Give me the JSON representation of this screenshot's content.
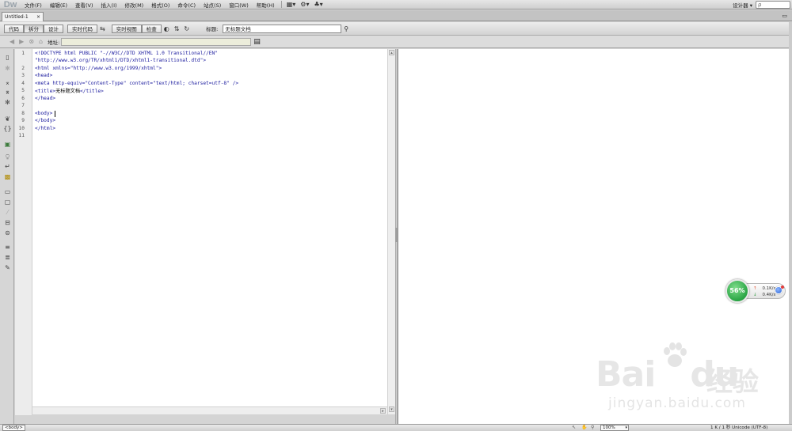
{
  "app": {
    "logo": "Dw"
  },
  "menubar": {
    "items": [
      "文件(F)",
      "编辑(E)",
      "查看(V)",
      "插入(I)",
      "修改(M)",
      "格式(O)",
      "命令(C)",
      "站点(S)",
      "窗口(W)",
      "帮助(H)"
    ],
    "layout_icon": "▦▾",
    "extend_icon": "⚙▾",
    "site_icon": "♣▾",
    "workspace": "设计器 ▾",
    "search_placeholder": "ρ"
  },
  "tabs": {
    "doc_tab": "Untitled-1",
    "close": "×",
    "restore": "▭"
  },
  "doc_toolbar": {
    "code": "代码",
    "split": "拆分",
    "design": "设计",
    "live_code": "实时代码",
    "live_view": "实时视图",
    "inspect": "检查",
    "title_label": "标题:",
    "title_value": "无标题文档"
  },
  "address_bar": {
    "label": "地址:",
    "value": ""
  },
  "code_lines": [
    "<!DOCTYPE html PUBLIC \"-//W3C//DTD XHTML 1.0 Transitional//EN\"",
    "\"http://www.w3.org/TR/xhtml1/DTD/xhtml1-transitional.dtd\">",
    "<html xmlns=\"http://www.w3.org/1999/xhtml\">",
    "<head>",
    "<meta http-equiv=\"Content-Type\" content=\"text/html; charset=utf-8\" />",
    "<title>",
    "无标题文档",
    "</title>",
    "</head>",
    "",
    "<body>",
    "</body>",
    "</html>"
  ],
  "line_numbers": [
    "1",
    "2",
    "3",
    "4",
    "5",
    "6",
    "7",
    "8",
    "9",
    "10",
    "11"
  ],
  "net_widget": {
    "percent": "56%",
    "up": "0.1K/s",
    "down": "0.4K/s",
    "up_arrow": "↑",
    "down_arrow": "↓"
  },
  "watermark": {
    "brand": "Bai",
    "brand2": "du",
    "cn": "经验",
    "url": "jingyan.baidu.com"
  },
  "status_bar": {
    "tag": "<body>",
    "zoom": "100%",
    "info": "1 K / 1 秒  Unicode (UTF-8)"
  }
}
